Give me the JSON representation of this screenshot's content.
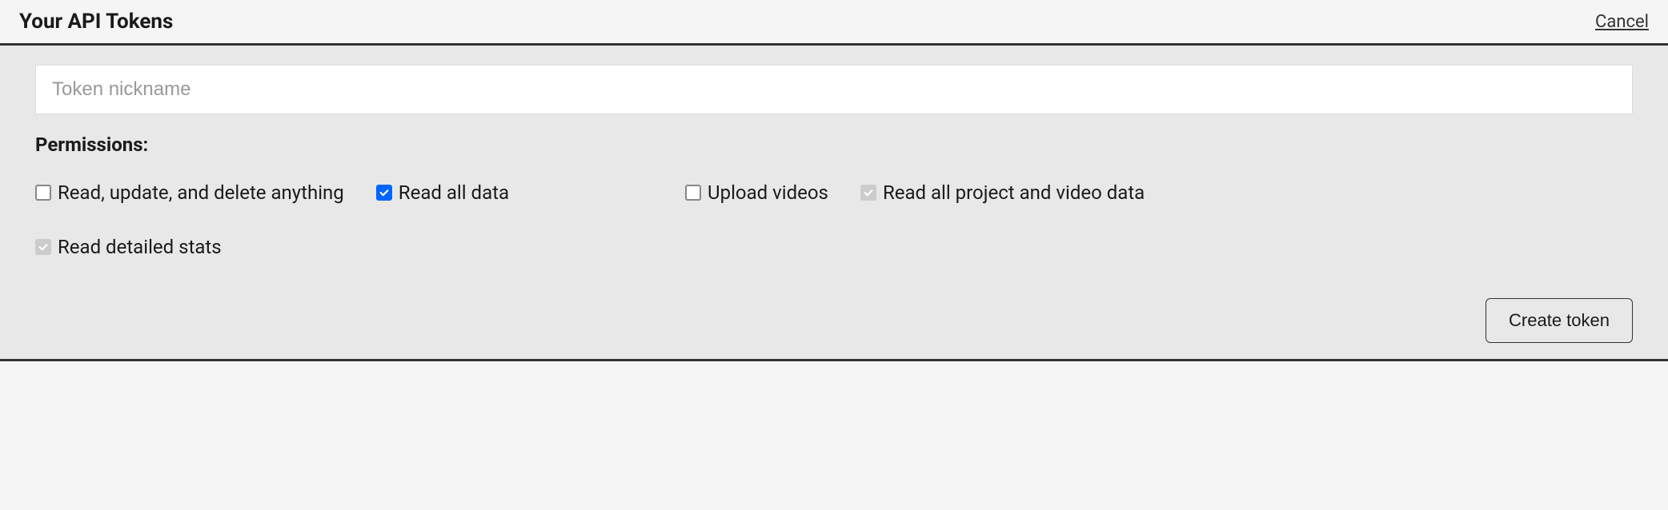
{
  "header": {
    "title": "Your API Tokens",
    "cancel_label": "Cancel"
  },
  "form": {
    "nickname_placeholder": "Token nickname",
    "nickname_value": "",
    "permissions_label": "Permissions:",
    "permissions": [
      {
        "label": "Read, update, and delete anything",
        "checked": false,
        "disabled": false
      },
      {
        "label": "Read all data",
        "checked": true,
        "disabled": false
      },
      {
        "label": "Upload videos",
        "checked": false,
        "disabled": false
      },
      {
        "label": "Read all project and video data",
        "checked": true,
        "disabled": true
      },
      {
        "label": "Read detailed stats",
        "checked": true,
        "disabled": true
      }
    ],
    "create_button_label": "Create token"
  }
}
